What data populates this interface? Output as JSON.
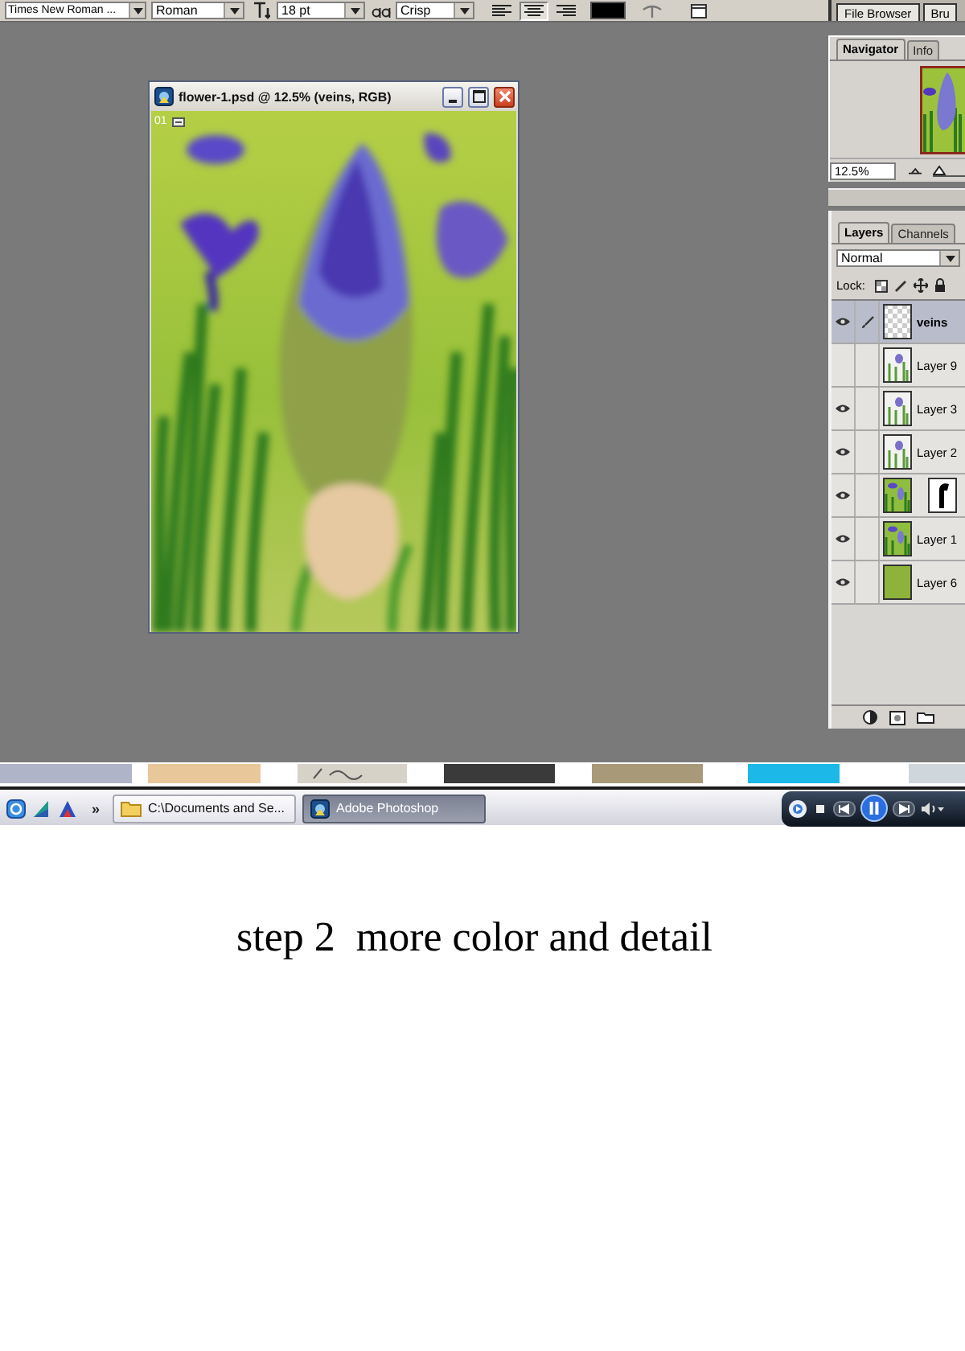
{
  "options_bar": {
    "font_family": "Times New Roman ...",
    "font_style": "Roman",
    "font_size": "18 pt",
    "antialias": "Crisp",
    "align": [
      {
        "kind": "left",
        "selected": false
      },
      {
        "kind": "center",
        "selected": true
      },
      {
        "kind": "right",
        "selected": false
      }
    ],
    "well_tabs": [
      "File Browser",
      "Bru"
    ]
  },
  "document": {
    "title": "flower-1.psd @ 12.5% (veins, RGB)",
    "frame_label": "01"
  },
  "navigator": {
    "tabs": [
      {
        "label": "Navigator",
        "selected": true
      },
      {
        "label": "Info",
        "selected": false
      }
    ],
    "zoom": "12.5%",
    "slider": {
      "level": 0.2
    }
  },
  "layers": {
    "tabs": [
      {
        "label": "Layers",
        "selected": true
      },
      {
        "label": "Channels",
        "selected": false
      }
    ],
    "blend_mode": "Normal",
    "lock_label": "Lock:",
    "items": [
      {
        "name": "veins",
        "visible": true,
        "selected": true,
        "kind": "transparent",
        "mask": false
      },
      {
        "name": "Layer 9",
        "visible": false,
        "selected": false,
        "kind": "cutout",
        "mask": false
      },
      {
        "name": "Layer 3",
        "visible": true,
        "selected": false,
        "kind": "cutout",
        "mask": false
      },
      {
        "name": "Layer 2",
        "visible": true,
        "selected": false,
        "kind": "cutout",
        "mask": false
      },
      {
        "visible": true,
        "selected": false,
        "kind": "image",
        "mask": true
      },
      {
        "name": "Layer 1",
        "visible": true,
        "selected": false,
        "kind": "image",
        "mask": false
      },
      {
        "name": "Layer 6",
        "visible": true,
        "selected": false,
        "kind": "fill",
        "mask": false
      }
    ]
  },
  "taskbar": {
    "more": "»",
    "tasks": [
      {
        "label": "C:\\Documents and Se...",
        "kind": "folder",
        "selected": false
      },
      {
        "label": "Adobe Photoshop",
        "kind": "photoshop",
        "selected": true
      }
    ]
  },
  "caption": "step 2  more color and detail"
}
